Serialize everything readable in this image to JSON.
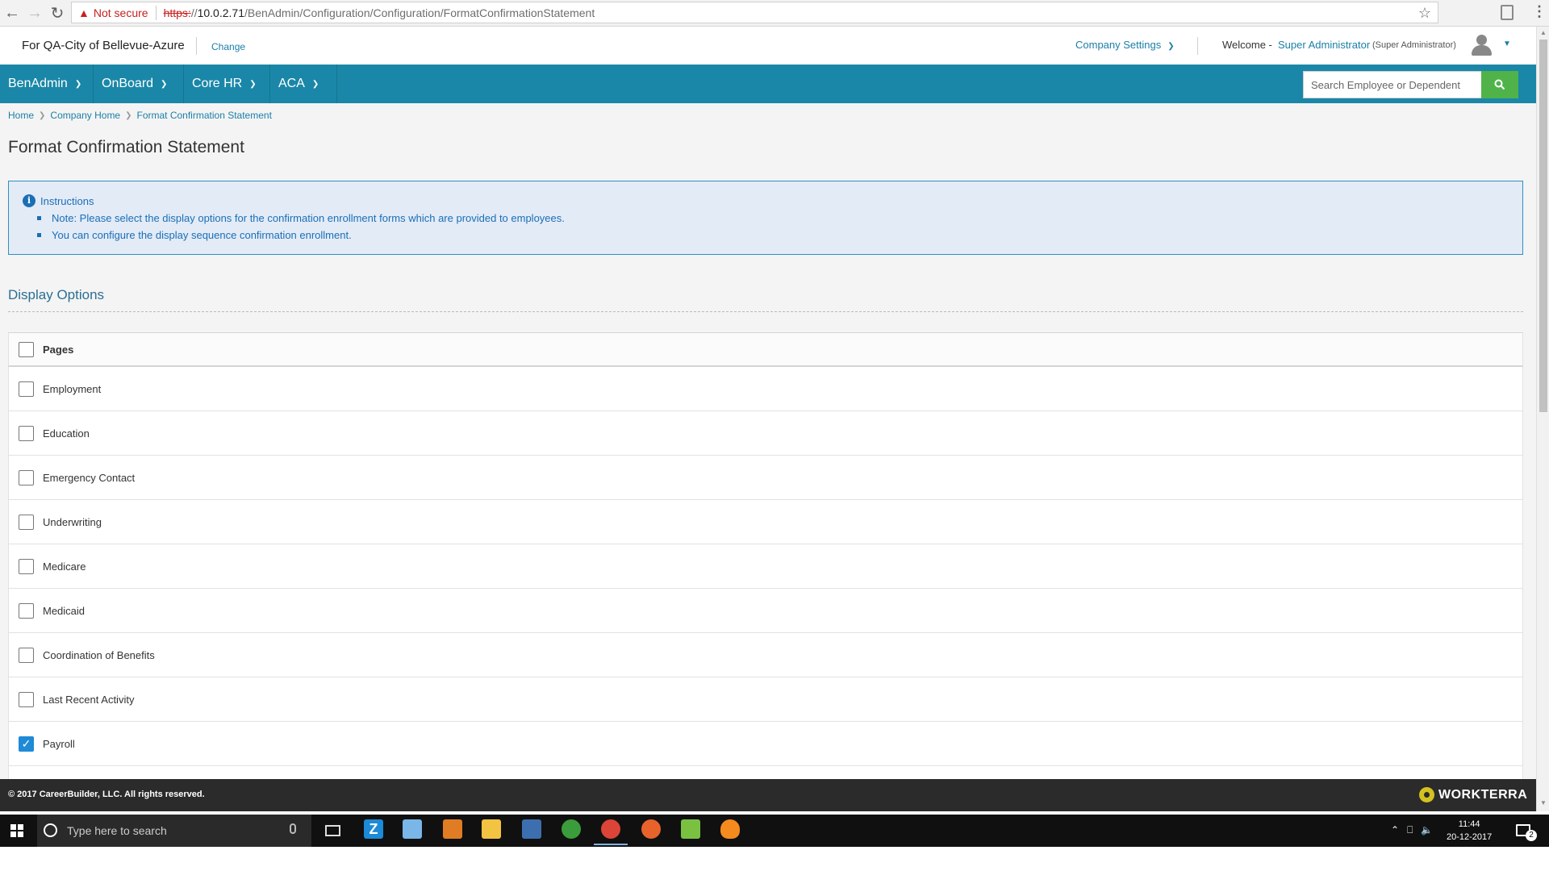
{
  "browser": {
    "security_warning": "Not secure",
    "url_scheme": "https:",
    "url_slashes": "//",
    "url_host": "10.0.2.71",
    "url_path": "/BenAdmin/Configuration/Configuration/FormatConfirmationStatement"
  },
  "header": {
    "company": "For QA-City of Bellevue-Azure",
    "change_label": "Change",
    "company_settings": "Company Settings",
    "welcome": "Welcome -",
    "user_name": "Super Administrator",
    "user_role": "(Super Administrator)"
  },
  "nav": {
    "items": [
      {
        "label": "BenAdmin"
      },
      {
        "label": "OnBoard"
      },
      {
        "label": "Core HR"
      },
      {
        "label": "ACA"
      }
    ],
    "search_placeholder": "Search Employee or Dependent"
  },
  "breadcrumb": [
    "Home",
    "Company Home",
    "Format Confirmation Statement"
  ],
  "page": {
    "title": "Format Confirmation Statement",
    "instructions_title": "Instructions",
    "instructions": [
      "Note: Please select the display options for the confirmation enrollment forms which are provided to employees.",
      "You can configure the display sequence confirmation enrollment."
    ],
    "section_title": "Display Options",
    "table_header": "Pages",
    "rows": [
      {
        "label": "Employment",
        "checked": false
      },
      {
        "label": "Education",
        "checked": false
      },
      {
        "label": "Emergency Contact",
        "checked": false
      },
      {
        "label": "Underwriting",
        "checked": false
      },
      {
        "label": "Medicare",
        "checked": false
      },
      {
        "label": "Medicaid",
        "checked": false
      },
      {
        "label": "Coordination of Benefits",
        "checked": false
      },
      {
        "label": "Last Recent Activity",
        "checked": false
      },
      {
        "label": "Payroll",
        "checked": true
      }
    ]
  },
  "footer": {
    "copyright": "© 2017 CareerBuilder, LLC. All rights reserved.",
    "logo_text": "WORKTERRA"
  },
  "taskbar": {
    "search_placeholder": "Type here to search",
    "time": "11:44",
    "date": "20-12-2017",
    "notification_count": "2"
  },
  "colors": {
    "nav_bg": "#1a87a8",
    "link": "#1a7fa8",
    "search_button": "#4fb34a",
    "instructions_bg": "#e3ebf7",
    "checkbox_checked": "#1f8ad6"
  }
}
